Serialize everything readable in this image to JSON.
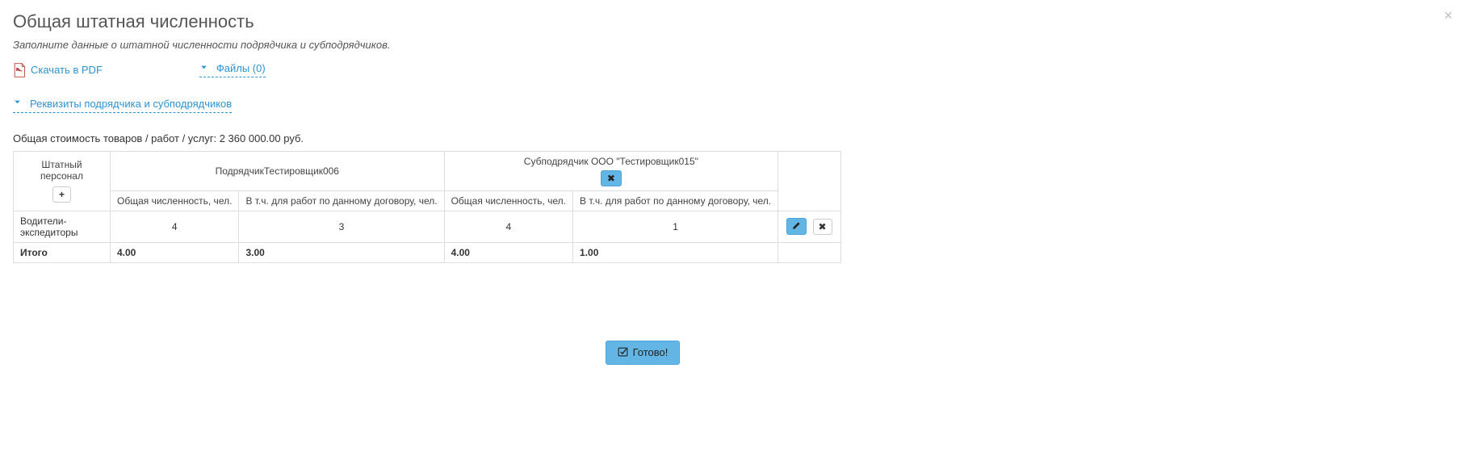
{
  "header": {
    "title": "Общая штатная численность",
    "subtitle": "Заполните данные о штатной численности подрядчика и субподрядчиков."
  },
  "links": {
    "download_pdf": "Скачать в PDF",
    "files_label": "Файлы (0)",
    "requisites_label": "Реквизиты подрядчика и субподрядчиков"
  },
  "summary": {
    "total_cost_text": "Общая стоимость товаров / работ / услуг: 2 360 000.00 руб."
  },
  "table": {
    "headers": {
      "staff": "Штатный персонал",
      "contractor": "ПодрядчикТестировщик006",
      "subcontractor": "Субподрядчик ООО \"Тестировщик015\"",
      "col_total": "Общая численность, чел.",
      "col_contract": "В т.ч. для работ по данному договору, чел."
    },
    "rows": [
      {
        "label": "Водители-экспедиторы",
        "c_total": "4",
        "c_contract": "3",
        "s_total": "4",
        "s_contract": "1"
      }
    ],
    "totals": {
      "label": "Итого",
      "c_total": "4.00",
      "c_contract": "3.00",
      "s_total": "4.00",
      "s_contract": "1.00"
    }
  },
  "buttons": {
    "ready": "Готово!"
  }
}
